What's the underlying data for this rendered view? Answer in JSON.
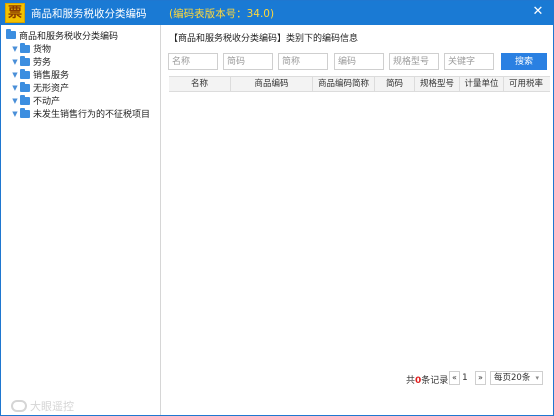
{
  "window": {
    "icon_glyph": "票",
    "title": "商品和服务税收分类编码",
    "version": "(编码表版本号：34.0)",
    "close_glyph": "✕"
  },
  "sidebar": {
    "root_label": "商品和服务税收分类编码",
    "items": [
      {
        "label": "货物"
      },
      {
        "label": "劳务"
      },
      {
        "label": "销售服务"
      },
      {
        "label": "无形资产"
      },
      {
        "label": "不动产"
      },
      {
        "label": "未发生销售行为的不征税项目"
      }
    ]
  },
  "main": {
    "info_line": "【商品和服务税收分类编码】类别下的编码信息",
    "filters": {
      "name": "名称",
      "short_code": "简码",
      "short_name": "简称",
      "code": "编码",
      "spec": "规格型号",
      "keyword": "关键字"
    },
    "search_label": "搜索",
    "columns": [
      "名称",
      "商品编码",
      "商品编码简称",
      "简码",
      "规格型号",
      "计量单位",
      "可用税率"
    ]
  },
  "pager": {
    "total_prefix": "共",
    "total_count": "0",
    "total_suffix": "条记录",
    "prev": "«",
    "page": "1",
    "next": "»",
    "page_size": "每页20条",
    "caret": "▾"
  },
  "watermark": {
    "text": "大眼遥控"
  },
  "colors": {
    "titlebar": "#1a7ad4",
    "version_text": "#ffd83a",
    "search_button": "#2a80e2",
    "folder": "#3c8ee0",
    "count_highlight": "#e02020"
  }
}
